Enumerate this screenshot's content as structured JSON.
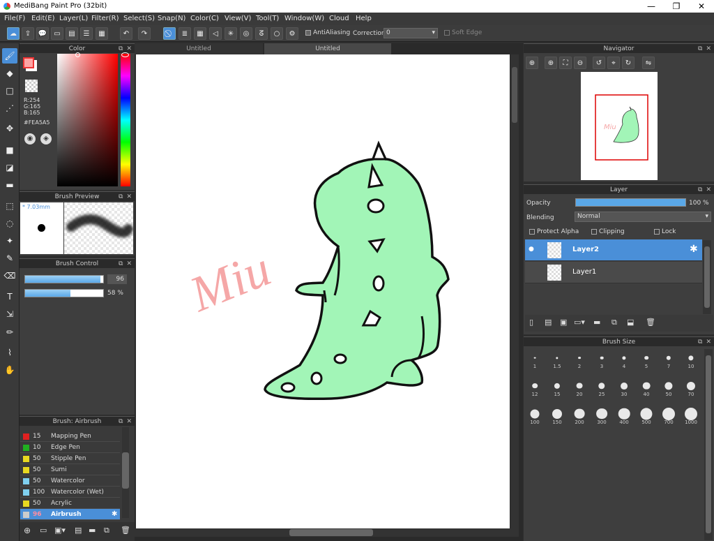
{
  "window": {
    "title": "MediBang Paint Pro (32bit)",
    "minimize": "—",
    "restore": "❐",
    "close": "✕"
  },
  "menu": [
    "File(F)",
    "Edit(E)",
    "Layer(L)",
    "Filter(R)",
    "Select(S)",
    "Snap(N)",
    "Color(C)",
    "View(V)",
    "Tool(T)",
    "Window(W)",
    "Cloud",
    "Help"
  ],
  "toolbar": {
    "antialiasing": "AntiAliasing",
    "correction_label": "Correction",
    "correction_value": "0",
    "soft_edge": "Soft Edge"
  },
  "color_panel": {
    "title": "Color",
    "r": "R:254",
    "g": "G:165",
    "b": "B:165",
    "hex": "#FEA5A5",
    "fg": "#FEA5A5"
  },
  "brush_preview": {
    "title": "Brush Preview",
    "size": "* 7.03mm"
  },
  "brush_control": {
    "title": "Brush Control",
    "size_value": "96",
    "opacity_value": "58 %",
    "size_fraction": 0.96,
    "opacity_fraction": 0.58
  },
  "brush_list": {
    "title": "Brush: Airbrush",
    "items": [
      {
        "size": "15",
        "name": "Mapping Pen",
        "color": "#e02020"
      },
      {
        "size": "10",
        "name": "Edge Pen",
        "color": "#20b020"
      },
      {
        "size": "50",
        "name": "Stipple Pen",
        "color": "#e8d820"
      },
      {
        "size": "50",
        "name": "Sumi",
        "color": "#e8d820"
      },
      {
        "size": "50",
        "name": "Watercolor",
        "color": "#7fd0f0"
      },
      {
        "size": "100",
        "name": "Watercolor (Wet)",
        "color": "#7fd0f0"
      },
      {
        "size": "50",
        "name": "Acrylic",
        "color": "#e8d820"
      },
      {
        "size": "96",
        "name": "Airbrush",
        "color": "#cccccc"
      }
    ]
  },
  "tabs": [
    "Untitled",
    "Untitled"
  ],
  "canvas": {
    "handwriting": "Miu"
  },
  "navigator": {
    "title": "Navigator"
  },
  "layer_panel": {
    "title": "Layer",
    "opacity_label": "Opacity",
    "opacity_value": "100 %",
    "blending_label": "Blending",
    "blending_value": "Normal",
    "protect_alpha": "Protect Alpha",
    "clipping": "Clipping",
    "lock": "Lock",
    "layers": [
      {
        "name": "Layer2",
        "selected": true
      },
      {
        "name": "Layer1",
        "selected": false
      }
    ]
  },
  "brush_size": {
    "title": "Brush Size",
    "sizes": [
      "1",
      "1.5",
      "2",
      "3",
      "4",
      "5",
      "7",
      "10",
      "12",
      "15",
      "20",
      "25",
      "30",
      "40",
      "50",
      "70",
      "100",
      "150",
      "200",
      "300",
      "400",
      "500",
      "700",
      "1000"
    ]
  }
}
